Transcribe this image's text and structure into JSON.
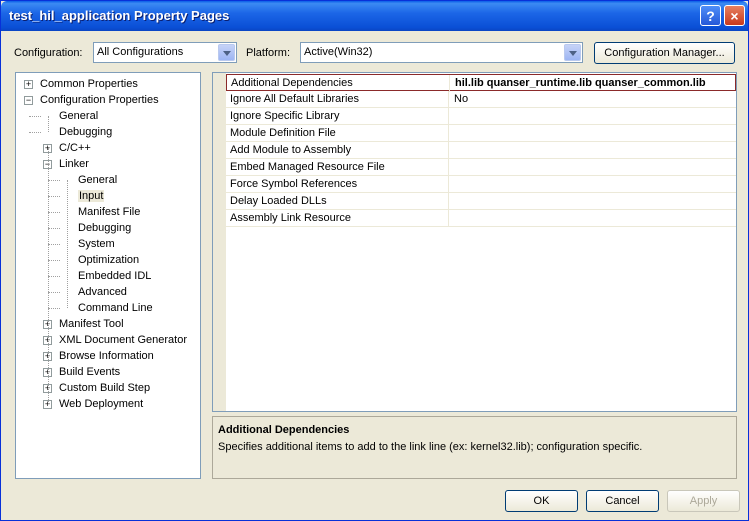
{
  "window": {
    "title": "test_hil_application Property Pages",
    "help": "?",
    "close": "×"
  },
  "toolbar": {
    "configuration_label": "Configuration:",
    "configuration_value": "All Configurations",
    "platform_label": "Platform:",
    "platform_value": "Active(Win32)",
    "config_manager_label": "Configuration Manager..."
  },
  "tree": [
    {
      "label": "Common Properties",
      "level": 0,
      "expander": "+"
    },
    {
      "label": "Configuration Properties",
      "level": 0,
      "expander": "−"
    },
    {
      "label": "General",
      "level": 1,
      "expander": ""
    },
    {
      "label": "Debugging",
      "level": 1,
      "expander": ""
    },
    {
      "label": "C/C++",
      "level": 1,
      "expander": "+"
    },
    {
      "label": "Linker",
      "level": 1,
      "expander": "−"
    },
    {
      "label": "General",
      "level": 2,
      "expander": ""
    },
    {
      "label": "Input",
      "level": 2,
      "expander": "",
      "selected": true
    },
    {
      "label": "Manifest File",
      "level": 2,
      "expander": ""
    },
    {
      "label": "Debugging",
      "level": 2,
      "expander": ""
    },
    {
      "label": "System",
      "level": 2,
      "expander": ""
    },
    {
      "label": "Optimization",
      "level": 2,
      "expander": ""
    },
    {
      "label": "Embedded IDL",
      "level": 2,
      "expander": ""
    },
    {
      "label": "Advanced",
      "level": 2,
      "expander": ""
    },
    {
      "label": "Command Line",
      "level": 2,
      "expander": ""
    },
    {
      "label": "Manifest Tool",
      "level": 1,
      "expander": "+"
    },
    {
      "label": "XML Document Generator",
      "level": 1,
      "expander": "+"
    },
    {
      "label": "Browse Information",
      "level": 1,
      "expander": "+"
    },
    {
      "label": "Build Events",
      "level": 1,
      "expander": "+"
    },
    {
      "label": "Custom Build Step",
      "level": 1,
      "expander": "+"
    },
    {
      "label": "Web Deployment",
      "level": 1,
      "expander": "+"
    }
  ],
  "properties": [
    {
      "name": "Additional Dependencies",
      "value": "hil.lib quanser_runtime.lib quanser_common.lib",
      "selected": true
    },
    {
      "name": "Ignore All Default Libraries",
      "value": "No"
    },
    {
      "name": "Ignore Specific Library",
      "value": ""
    },
    {
      "name": "Module Definition File",
      "value": ""
    },
    {
      "name": "Add Module to Assembly",
      "value": ""
    },
    {
      "name": "Embed Managed Resource File",
      "value": ""
    },
    {
      "name": "Force Symbol References",
      "value": ""
    },
    {
      "name": "Delay Loaded DLLs",
      "value": ""
    },
    {
      "name": "Assembly Link Resource",
      "value": ""
    }
  ],
  "description": {
    "title": "Additional Dependencies",
    "text": "Specifies additional items to add to the link line (ex: kernel32.lib); configuration specific."
  },
  "buttons": {
    "ok": "OK",
    "cancel": "Cancel",
    "apply": "Apply"
  }
}
